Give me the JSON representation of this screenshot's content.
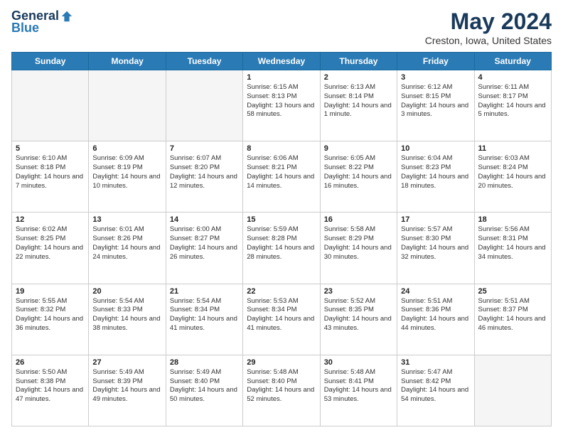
{
  "header": {
    "logo": {
      "general": "General",
      "blue": "Blue"
    },
    "title": "May 2024",
    "location": "Creston, Iowa, United States"
  },
  "days_of_week": [
    "Sunday",
    "Monday",
    "Tuesday",
    "Wednesday",
    "Thursday",
    "Friday",
    "Saturday"
  ],
  "weeks": [
    [
      {
        "day": "",
        "empty": true
      },
      {
        "day": "",
        "empty": true
      },
      {
        "day": "",
        "empty": true
      },
      {
        "day": "1",
        "sunrise": "6:15 AM",
        "sunset": "8:13 PM",
        "daylight": "13 hours and 58 minutes."
      },
      {
        "day": "2",
        "sunrise": "6:13 AM",
        "sunset": "8:14 PM",
        "daylight": "14 hours and 1 minute."
      },
      {
        "day": "3",
        "sunrise": "6:12 AM",
        "sunset": "8:15 PM",
        "daylight": "14 hours and 3 minutes."
      },
      {
        "day": "4",
        "sunrise": "6:11 AM",
        "sunset": "8:17 PM",
        "daylight": "14 hours and 5 minutes."
      }
    ],
    [
      {
        "day": "5",
        "sunrise": "6:10 AM",
        "sunset": "8:18 PM",
        "daylight": "14 hours and 7 minutes."
      },
      {
        "day": "6",
        "sunrise": "6:09 AM",
        "sunset": "8:19 PM",
        "daylight": "14 hours and 10 minutes."
      },
      {
        "day": "7",
        "sunrise": "6:07 AM",
        "sunset": "8:20 PM",
        "daylight": "14 hours and 12 minutes."
      },
      {
        "day": "8",
        "sunrise": "6:06 AM",
        "sunset": "8:21 PM",
        "daylight": "14 hours and 14 minutes."
      },
      {
        "day": "9",
        "sunrise": "6:05 AM",
        "sunset": "8:22 PM",
        "daylight": "14 hours and 16 minutes."
      },
      {
        "day": "10",
        "sunrise": "6:04 AM",
        "sunset": "8:23 PM",
        "daylight": "14 hours and 18 minutes."
      },
      {
        "day": "11",
        "sunrise": "6:03 AM",
        "sunset": "8:24 PM",
        "daylight": "14 hours and 20 minutes."
      }
    ],
    [
      {
        "day": "12",
        "sunrise": "6:02 AM",
        "sunset": "8:25 PM",
        "daylight": "14 hours and 22 minutes."
      },
      {
        "day": "13",
        "sunrise": "6:01 AM",
        "sunset": "8:26 PM",
        "daylight": "14 hours and 24 minutes."
      },
      {
        "day": "14",
        "sunrise": "6:00 AM",
        "sunset": "8:27 PM",
        "daylight": "14 hours and 26 minutes."
      },
      {
        "day": "15",
        "sunrise": "5:59 AM",
        "sunset": "8:28 PM",
        "daylight": "14 hours and 28 minutes."
      },
      {
        "day": "16",
        "sunrise": "5:58 AM",
        "sunset": "8:29 PM",
        "daylight": "14 hours and 30 minutes."
      },
      {
        "day": "17",
        "sunrise": "5:57 AM",
        "sunset": "8:30 PM",
        "daylight": "14 hours and 32 minutes."
      },
      {
        "day": "18",
        "sunrise": "5:56 AM",
        "sunset": "8:31 PM",
        "daylight": "14 hours and 34 minutes."
      }
    ],
    [
      {
        "day": "19",
        "sunrise": "5:55 AM",
        "sunset": "8:32 PM",
        "daylight": "14 hours and 36 minutes."
      },
      {
        "day": "20",
        "sunrise": "5:54 AM",
        "sunset": "8:33 PM",
        "daylight": "14 hours and 38 minutes."
      },
      {
        "day": "21",
        "sunrise": "5:54 AM",
        "sunset": "8:34 PM",
        "daylight": "14 hours and 41 minutes."
      },
      {
        "day": "22",
        "sunrise": "5:53 AM",
        "sunset": "8:34 PM",
        "daylight": "14 hours and 41 minutes."
      },
      {
        "day": "23",
        "sunrise": "5:52 AM",
        "sunset": "8:35 PM",
        "daylight": "14 hours and 43 minutes."
      },
      {
        "day": "24",
        "sunrise": "5:51 AM",
        "sunset": "8:36 PM",
        "daylight": "14 hours and 44 minutes."
      },
      {
        "day": "25",
        "sunrise": "5:51 AM",
        "sunset": "8:37 PM",
        "daylight": "14 hours and 46 minutes."
      }
    ],
    [
      {
        "day": "26",
        "sunrise": "5:50 AM",
        "sunset": "8:38 PM",
        "daylight": "14 hours and 47 minutes."
      },
      {
        "day": "27",
        "sunrise": "5:49 AM",
        "sunset": "8:39 PM",
        "daylight": "14 hours and 49 minutes."
      },
      {
        "day": "28",
        "sunrise": "5:49 AM",
        "sunset": "8:40 PM",
        "daylight": "14 hours and 50 minutes."
      },
      {
        "day": "29",
        "sunrise": "5:48 AM",
        "sunset": "8:40 PM",
        "daylight": "14 hours and 52 minutes."
      },
      {
        "day": "30",
        "sunrise": "5:48 AM",
        "sunset": "8:41 PM",
        "daylight": "14 hours and 53 minutes."
      },
      {
        "day": "31",
        "sunrise": "5:47 AM",
        "sunset": "8:42 PM",
        "daylight": "14 hours and 54 minutes."
      },
      {
        "day": "",
        "empty": true
      }
    ]
  ]
}
